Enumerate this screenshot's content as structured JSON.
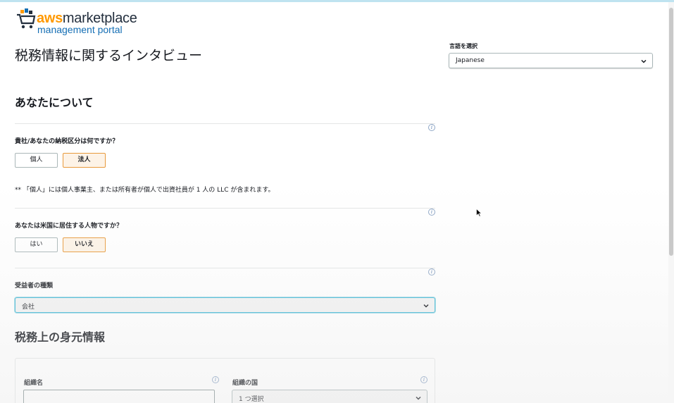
{
  "logo": {
    "brand_aws": "aws",
    "brand_rest": "marketplace",
    "subtitle": "management portal"
  },
  "page": {
    "title": "税務情報に関するインタビュー"
  },
  "language": {
    "label": "言語を選択",
    "selected": "Japanese"
  },
  "about_section": {
    "heading": "あなたについて"
  },
  "tax_classification": {
    "question": "貴社/あなたの納税区分は何ですか？",
    "options": [
      "個人",
      "法人"
    ],
    "selected_index": 1,
    "note": "** 「個人」には個人事業主、または所有者が個人で出資社員が 1 人の LLC が含まれます。"
  },
  "us_person": {
    "question": "あなたは米国に居住する人物ですか？",
    "options": [
      "はい",
      "いいえ"
    ],
    "selected_index": 1
  },
  "payee_type": {
    "label": "受益者の種類",
    "selected": "会社"
  },
  "identity_section": {
    "heading": "税務上の身元情報",
    "org_name_label": "組織名",
    "org_name_value": "",
    "country_label": "組織の国",
    "country_selected": "1 つ選択"
  },
  "colors": {
    "accent_orange": "#ff9900",
    "selected_border": "#e89a3c",
    "focus_blue": "#44b9d6",
    "link_blue": "#146eb4"
  }
}
